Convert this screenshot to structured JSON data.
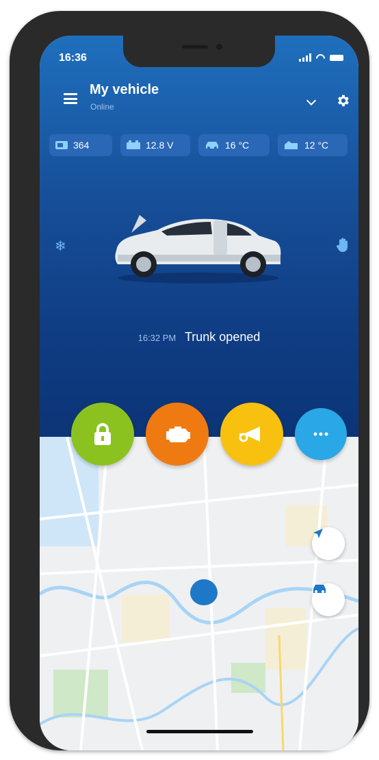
{
  "status_bar": {
    "time": "16:36"
  },
  "header": {
    "title": "My vehicle",
    "subtitle": "Online",
    "menu_icon": "hamburger-menu-icon",
    "settings_icon": "gear-icon"
  },
  "stats": [
    {
      "icon": "odometer-icon",
      "value": "364"
    },
    {
      "icon": "battery-icon",
      "value": "12.8 V"
    },
    {
      "icon": "car-temperature-icon",
      "value": "16 °C"
    },
    {
      "icon": "engine-temperature-icon",
      "value": "12 °C"
    }
  ],
  "vehicle": {
    "state_icon_left": "snowflake-icon",
    "state_icon_right": "hand-icon"
  },
  "event": {
    "time": "16:32 PM",
    "text": "Trunk opened"
  },
  "actions": [
    {
      "name": "lock",
      "icon": "padlock-icon",
      "color": "#8cc21f"
    },
    {
      "name": "engine",
      "icon": "engine-icon",
      "color": "#f07a12"
    },
    {
      "name": "horn",
      "icon": "horn-icon",
      "color": "#f8c10f"
    },
    {
      "name": "more",
      "icon": "more-dots-icon",
      "color": "#29a7e6"
    }
  ],
  "map": {
    "buttons": [
      "navigate-arrow-icon",
      "car-locate-icon"
    ],
    "pin_color": "#1e78c8"
  },
  "colors": {
    "header_top": "#1f6fbd",
    "header_bottom": "#0c3577",
    "water": "#a8d4f5",
    "park": "#cfe8c8"
  }
}
